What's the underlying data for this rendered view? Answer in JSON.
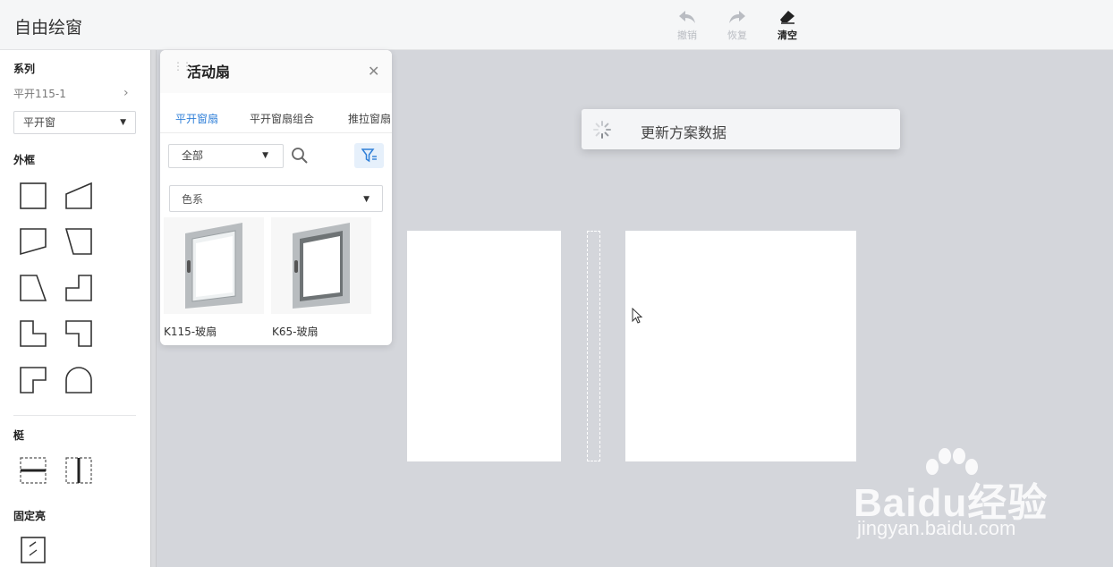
{
  "app": {
    "title": "自由绘窗"
  },
  "toolbar": {
    "undo_label": "撤销",
    "redo_label": "恢复",
    "clear_label": "清空"
  },
  "palette": {
    "series_title": "系列",
    "series_value": "平开115-1",
    "window_type_selected": "平开窗",
    "frame_title": "外框",
    "mullion_title": "梃",
    "fixed_title": "固定亮"
  },
  "panel": {
    "title": "活动扇",
    "tabs": [
      {
        "label": "平开窗扇",
        "active": true
      },
      {
        "label": "平开窗扇组合",
        "active": false
      },
      {
        "label": "推拉窗扇",
        "active": false
      }
    ],
    "category_selected": "全部",
    "color_filter_placeholder": "色系",
    "products": [
      {
        "name": "K115-玻扇"
      },
      {
        "name": "K65-玻扇"
      }
    ]
  },
  "canvas": {
    "toast_text": "更新方案数据"
  },
  "watermark": {
    "logo": "Baidu经验",
    "url": "jingyan.baidu.com"
  },
  "colors": {
    "accent": "#2f7fd8",
    "canvas_bg": "#d4d6db",
    "disabled": "#b9bcc2"
  }
}
